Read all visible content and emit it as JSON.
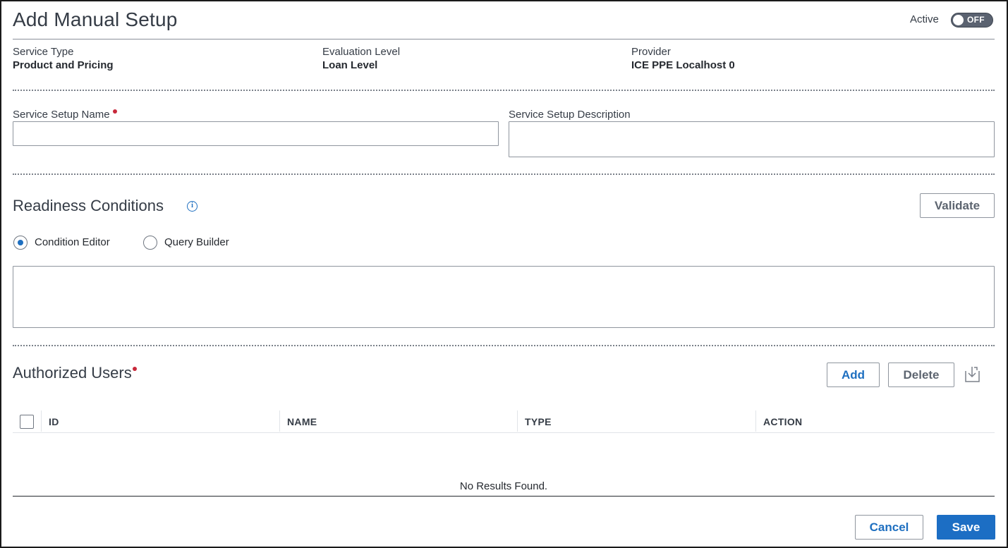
{
  "header": {
    "title": "Add Manual Setup",
    "active_label": "Active",
    "toggle_state": "OFF"
  },
  "info": {
    "service_type_label": "Service Type",
    "service_type_value": "Product and Pricing",
    "evaluation_level_label": "Evaluation Level",
    "evaluation_level_value": "Loan Level",
    "provider_label": "Provider",
    "provider_value": "ICE PPE Localhost 0"
  },
  "form": {
    "setup_name_label": "Service Setup Name",
    "setup_name_value": "",
    "setup_description_label": "Service Setup Description",
    "setup_description_value": ""
  },
  "readiness": {
    "title": "Readiness Conditions",
    "validate_label": "Validate",
    "radio_condition_editor": "Condition Editor",
    "radio_query_builder": "Query Builder",
    "selected": "Condition Editor",
    "condition_value": ""
  },
  "users": {
    "title": "Authorized Users",
    "add_label": "Add",
    "delete_label": "Delete",
    "columns": [
      "ID",
      "NAME",
      "TYPE",
      "ACTION"
    ],
    "rows": [],
    "empty_text": "No Results Found."
  },
  "footer": {
    "cancel_label": "Cancel",
    "save_label": "Save"
  },
  "colors": {
    "primary": "#1c6ec4",
    "required": "#c8283a",
    "toggle_off": "#5a6270"
  }
}
